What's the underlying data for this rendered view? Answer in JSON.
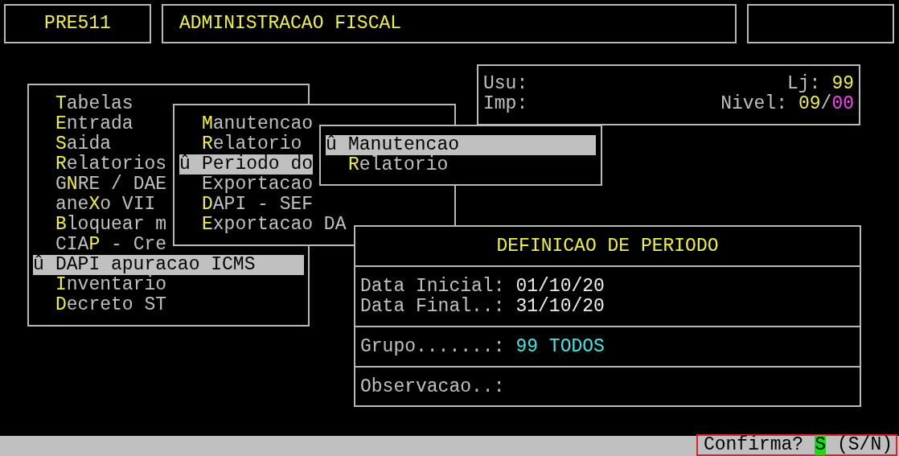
{
  "header": {
    "program": "PRE511",
    "title": "ADMINISTRACAO FISCAL"
  },
  "info": {
    "user_label": "Usu:",
    "printer_label": "Imp:",
    "store_label": "Lj:",
    "store": "99",
    "level_label": "Nivel:",
    "level_value": "09",
    "level_separator": "/",
    "level_max": "00"
  },
  "main_menu": [
    {
      "hotkey": "T",
      "after": "abelas",
      "selected": false
    },
    {
      "hotkey": "E",
      "after": "ntrada",
      "selected": false
    },
    {
      "hotkey": "S",
      "after": "aida",
      "selected": false
    },
    {
      "hotkey": "R",
      "after": "elatorios",
      "selected": false
    },
    {
      "before": "G",
      "hotkey": "N",
      "after": "RE / DAE",
      "selected": false
    },
    {
      "before": "ane",
      "hotkey": "X",
      "after": "o VII",
      "selected": false
    },
    {
      "hotkey": "B",
      "after": "loquear m",
      "selected": false
    },
    {
      "before": "CIA",
      "hotkey": "P",
      "after": " - Cre",
      "selected": false
    },
    {
      "marker": "û",
      "before": "DAPI apuracao ICMS",
      "selected": true
    },
    {
      "hotkey": "I",
      "after": "nventario",
      "selected": false
    },
    {
      "hotkey": "D",
      "after": "ecreto ST",
      "selected": false
    }
  ],
  "submenu": [
    {
      "hotkey": "M",
      "after": "anutencao",
      "selected": false
    },
    {
      "hotkey": "R",
      "after": "elatorio",
      "selected": false
    },
    {
      "marker": "û",
      "before": "Periodo do",
      "selected": true
    },
    {
      "before": "Exportacao",
      "selected": false
    },
    {
      "hotkey": "D",
      "after": "API - SEF",
      "selected": false
    },
    {
      "hotkey": "E",
      "after": "xportacao DA",
      "selected": false
    }
  ],
  "submenu_2": [
    {
      "marker": "û",
      "before": "Manutencao",
      "selected": true
    },
    {
      "hotkey": "R",
      "after": "elatorio",
      "selected": false
    }
  ],
  "dialog": {
    "title": "DEFINICAO DE PERIODO",
    "sections": [
      {
        "fields": [
          {
            "kind": "date",
            "label": "Data Inicial:",
            "value": "01/10/20"
          },
          {
            "kind": "date",
            "label": "Data Final..:",
            "value": "31/10/20"
          }
        ]
      },
      {
        "fields": [
          {
            "kind": "code",
            "label": "Grupo.......:",
            "value": "99 TODOS"
          }
        ]
      },
      {
        "fields": [
          {
            "label": "Observacao..:"
          }
        ]
      }
    ]
  },
  "status_bar": {
    "prompt": "Confirma?",
    "answer": "S",
    "options": "(S/N)"
  }
}
